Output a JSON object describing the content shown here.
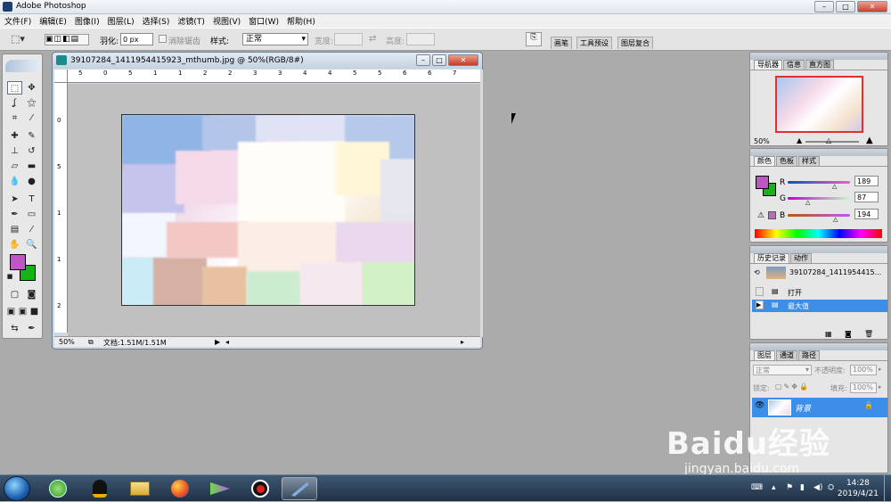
{
  "app": {
    "title": "Adobe Photoshop"
  },
  "window_buttons": {
    "min": "–",
    "max": "□",
    "close": "✕"
  },
  "menu": [
    "文件(F)",
    "编辑(E)",
    "图像(I)",
    "图层(L)",
    "选择(S)",
    "滤镜(T)",
    "视图(V)",
    "窗口(W)",
    "帮助(H)"
  ],
  "options": {
    "feather_label": "羽化:",
    "feather_value": "0 px",
    "antialias_label": "消除锯齿",
    "style_label": "样式:",
    "style_value": "正常",
    "width_label": "宽度:",
    "height_label": "高度:",
    "tabs": [
      "画笔",
      "工具预设",
      "图层复合"
    ]
  },
  "document": {
    "title": "39107284_1411954415923_mthumb.jpg @ 50%(RGB/8#)",
    "ruler_top": [
      "5",
      "0",
      "5",
      "1",
      "1",
      "2",
      "2",
      "3",
      "3",
      "4",
      "4",
      "5",
      "5",
      "6",
      "6",
      "7"
    ],
    "ruler_left": [
      "0",
      "5",
      "1",
      "1",
      "2"
    ],
    "zoom": "50%",
    "doc_info": "文档:1.51M/1.51M"
  },
  "navigator": {
    "tabs": [
      "导航器",
      "信息",
      "直方图"
    ],
    "zoom": "50%"
  },
  "color": {
    "tabs": [
      "颜色",
      "色板",
      "样式"
    ],
    "foreground": "#bd57c2",
    "background": "#16b219",
    "r_label": "R",
    "g_label": "G",
    "b_label": "B",
    "r": "189",
    "g": "87",
    "b": "194"
  },
  "history": {
    "tabs": [
      "历史记录",
      "动作"
    ],
    "snapshot": "39107284_1411954415...",
    "items": [
      "打开",
      "最大值"
    ],
    "selected_index": 1
  },
  "layers": {
    "tabs": [
      "图层",
      "通道",
      "路径"
    ],
    "blend_mode": "正常",
    "opacity_label": "不透明度:",
    "opacity": "100%",
    "lock_label": "锁定:",
    "fill_label": "填充:",
    "fill": "100%",
    "layer_name": "背景"
  },
  "taskbar": {
    "time": "14:28",
    "date": "2019/4/21"
  },
  "watermark": {
    "brand": "Baidu经验",
    "url": "jingyan.baidu.com"
  }
}
